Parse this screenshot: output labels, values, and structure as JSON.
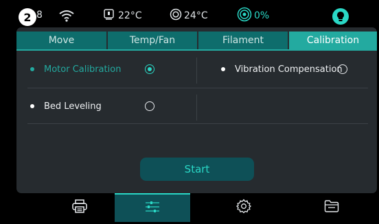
{
  "status_bar": {
    "badge_number": "2",
    "clipped_digit": "8",
    "hotend_temp": "22°C",
    "bed_temp": "24°C",
    "fan_percent": "0%",
    "icons": [
      "wifi-icon",
      "hotend-icon",
      "bed-icon",
      "fan-icon",
      "light-bulb-icon"
    ]
  },
  "tabs": [
    {
      "label": "Move",
      "active": false
    },
    {
      "label": "Temp/Fan",
      "active": false
    },
    {
      "label": "Filament",
      "active": false
    },
    {
      "label": "Calibration",
      "active": true
    }
  ],
  "calibration_options": [
    {
      "label": "Motor Calibration",
      "selected": true
    },
    {
      "label": "Vibration Compensation",
      "selected": false
    },
    {
      "label": "Bed Leveling",
      "selected": false
    }
  ],
  "start_button": {
    "label": "Start"
  },
  "bottom_nav": [
    {
      "name": "print",
      "icon": "printer-icon",
      "active": false
    },
    {
      "name": "control",
      "icon": "sliders-icon",
      "active": true
    },
    {
      "name": "settings",
      "icon": "gear-icon",
      "active": false
    },
    {
      "name": "files",
      "icon": "folder-icon",
      "active": false
    }
  ],
  "colors": {
    "accent": "#23aaa0",
    "accent_light": "#2ad8c6",
    "panel": "#262b2f",
    "tab_inactive": "#0e6d6c",
    "button_bg": "#0e5057"
  }
}
